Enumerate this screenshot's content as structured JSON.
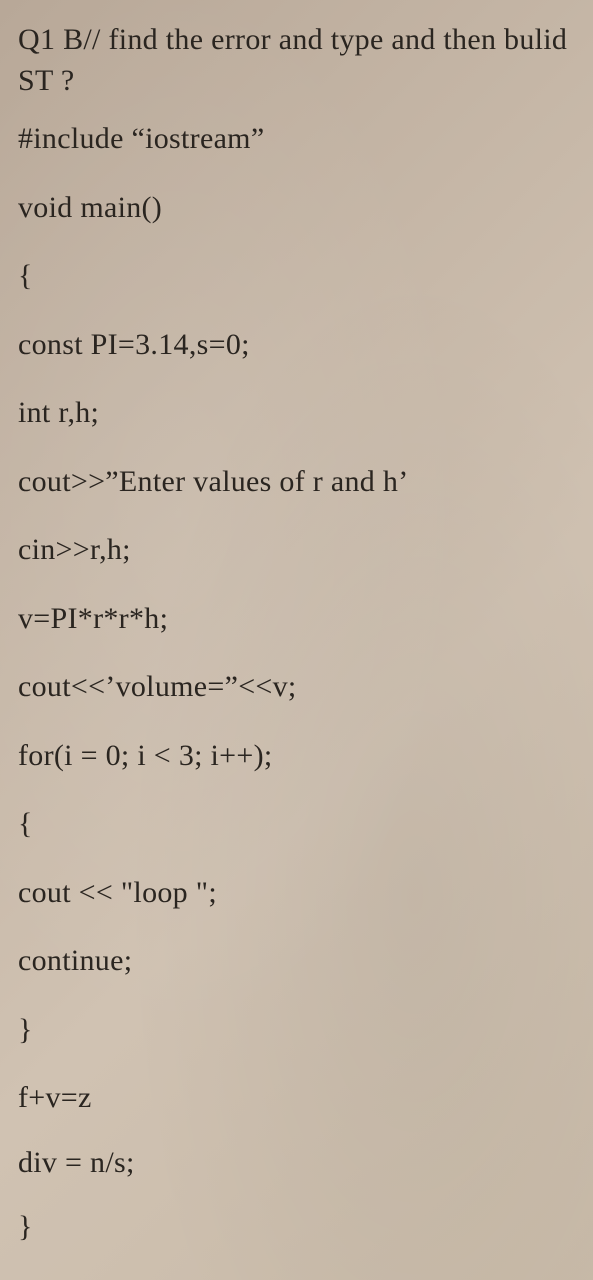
{
  "lines": {
    "l1": "Q1 B// find the error and type and then bulid ST ?",
    "l2": "#include “iostream”",
    "l3": "void main()",
    "l4": "{",
    "l5": "const PI=3.14,s=0;",
    "l6": "int r,h;",
    "l7": "cout>>”Enter values of r and h’",
    "l8": "cin>>r,h;",
    "l9": "v=PI*r*r*h;",
    "l10": "cout<<’volume=”<<v;",
    "l11": "for(i = 0; i < 3; i++);",
    "l12": "{",
    "l13": "cout << \"loop \";",
    "l14": "continue;",
    "l15": "}",
    "l16": "f+v=z",
    "l17": "div = n/s;",
    "l18": "}"
  }
}
